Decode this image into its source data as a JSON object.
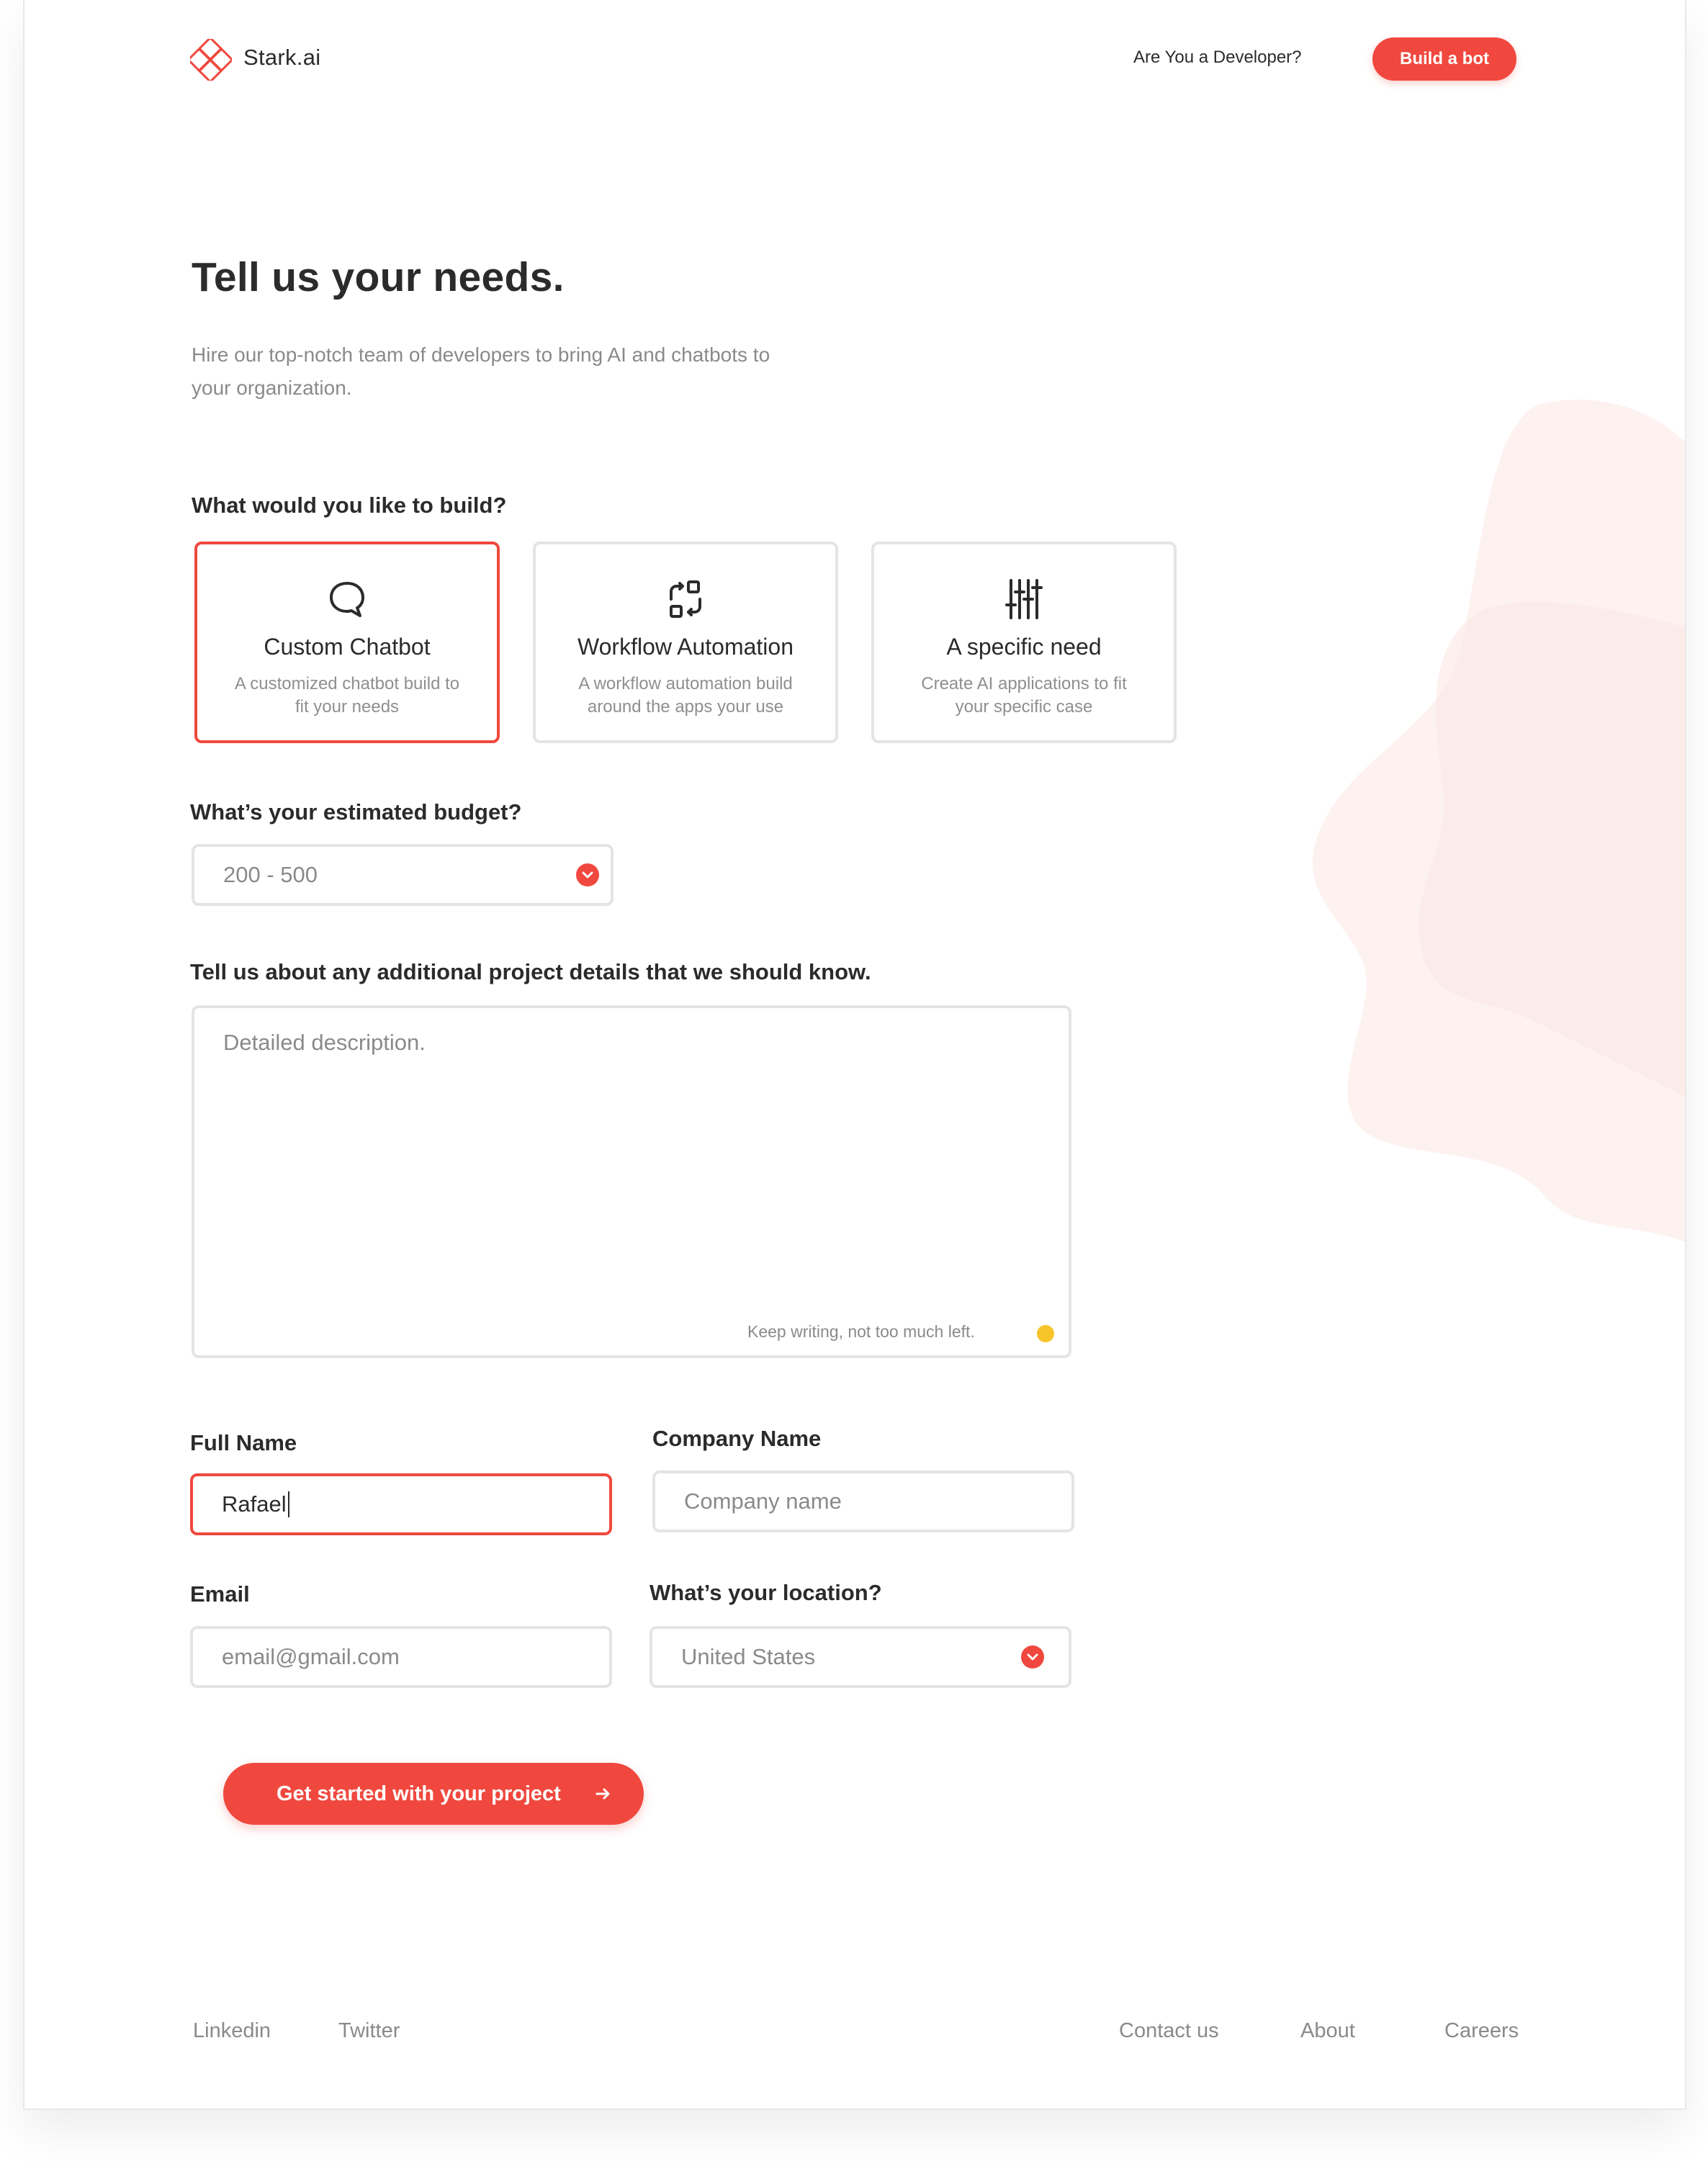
{
  "header": {
    "brand": "Stark.ai",
    "developer_link": "Are You a Developer?",
    "build_button": "Build a bot"
  },
  "hero": {
    "title": "Tell us your needs.",
    "subtitle": "Hire our top-notch team of developers to bring AI and chatbots to your organization."
  },
  "build": {
    "question": "What would you like to build?",
    "options": [
      {
        "title": "Custom Chatbot",
        "description": "A customized chatbot build to fit your needs",
        "icon": "chat-bubble-icon",
        "selected": true
      },
      {
        "title": "Workflow Automation",
        "description": "A workflow automation build around the apps your use",
        "icon": "workflow-icon",
        "selected": false
      },
      {
        "title": "A specific need",
        "description": "Create AI applications to fit your specific case",
        "icon": "sliders-icon",
        "selected": false
      }
    ]
  },
  "budget": {
    "question": "What’s your estimated budget?",
    "value": "200 - 500"
  },
  "details": {
    "question": "Tell us about any additional project details that we should know.",
    "placeholder": "Detailed description.",
    "counter_hint": "Keep writing, not too much left."
  },
  "contact": {
    "full_name_label": "Full Name",
    "full_name_value": "Rafael",
    "company_label": "Company Name",
    "company_placeholder": "Company name",
    "email_label": "Email",
    "email_placeholder": "email@gmail.com",
    "location_label": "What’s your location?",
    "location_value": "United States"
  },
  "submit": {
    "label": "Get started with your project"
  },
  "footer": {
    "left": [
      "Linkedin",
      "Twitter"
    ],
    "right": [
      "Contact us",
      "About",
      "Careers"
    ]
  },
  "colors": {
    "accent": "#f0483e",
    "indicator": "#f7c42a",
    "blob": "#fdf1ef"
  }
}
